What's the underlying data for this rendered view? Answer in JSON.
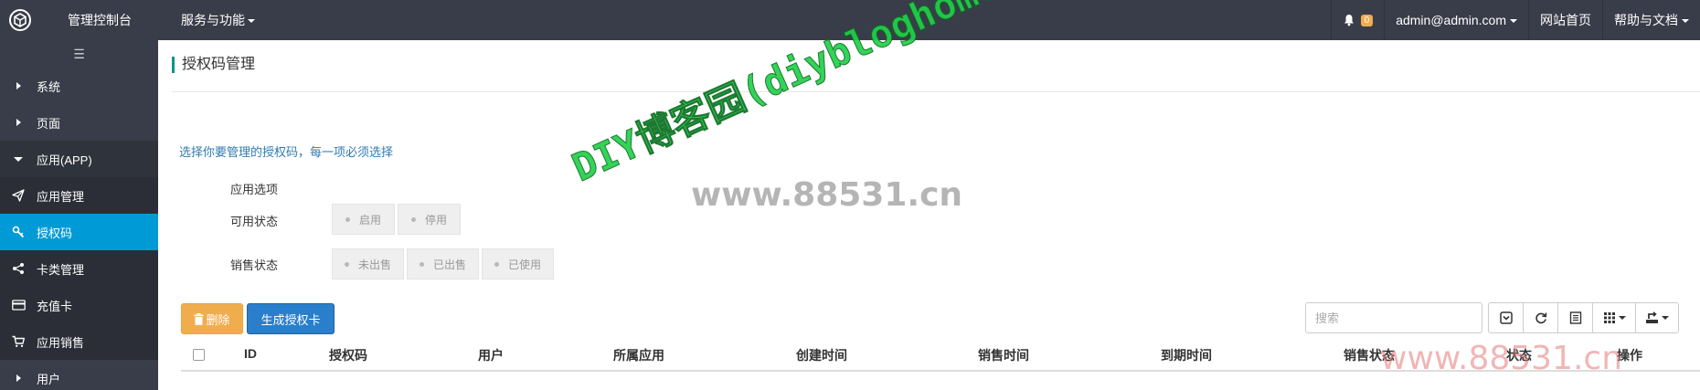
{
  "topbar": {
    "brand": "管理控制台",
    "services": "服务与功能",
    "notification_count": "0",
    "user": "admin@admin.com",
    "home": "网站首页",
    "help": "帮助与文档"
  },
  "sidebar": {
    "toggle": "☰",
    "items": [
      {
        "label": "系统"
      },
      {
        "label": "页面"
      },
      {
        "label": "应用(APP)"
      }
    ],
    "sub_items": [
      {
        "label": "应用管理",
        "icon": "paper-plane-icon"
      },
      {
        "label": "授权码",
        "icon": "key-icon"
      },
      {
        "label": "卡类管理",
        "icon": "share-icon"
      },
      {
        "label": "充值卡",
        "icon": "credit-card-icon"
      },
      {
        "label": "应用销售",
        "icon": "cart-icon"
      }
    ],
    "last_item": "用户"
  },
  "main": {
    "title": "授权码管理",
    "hint": "选择你要管理的授权码，每一项必须选择",
    "app_option_label": "应用选项",
    "status_label": "可用状态",
    "status_options": [
      "启用",
      "停用"
    ],
    "sale_label": "销售状态",
    "sale_options": [
      "未出售",
      "已出售",
      "已使用"
    ],
    "delete_button": "删除",
    "generate_button": "生成授权卡",
    "search_placeholder": "搜索"
  },
  "table": {
    "headers": [
      "ID",
      "授权码",
      "用户",
      "所属应用",
      "创建时间",
      "销售时间",
      "到期时间",
      "销售状态",
      "状态",
      "操作"
    ]
  },
  "watermarks": {
    "diagonal": "DIY博客园(diybloghome.com)",
    "center": "www.88531.cn",
    "corner": "www.88531.cn"
  },
  "colors": {
    "topbar_bg": "#393d49",
    "active_item": "#009ad6",
    "delete_btn": "#f0ad4e",
    "generate_btn": "#2a7fcc",
    "watermark_green": "#22d04a"
  }
}
